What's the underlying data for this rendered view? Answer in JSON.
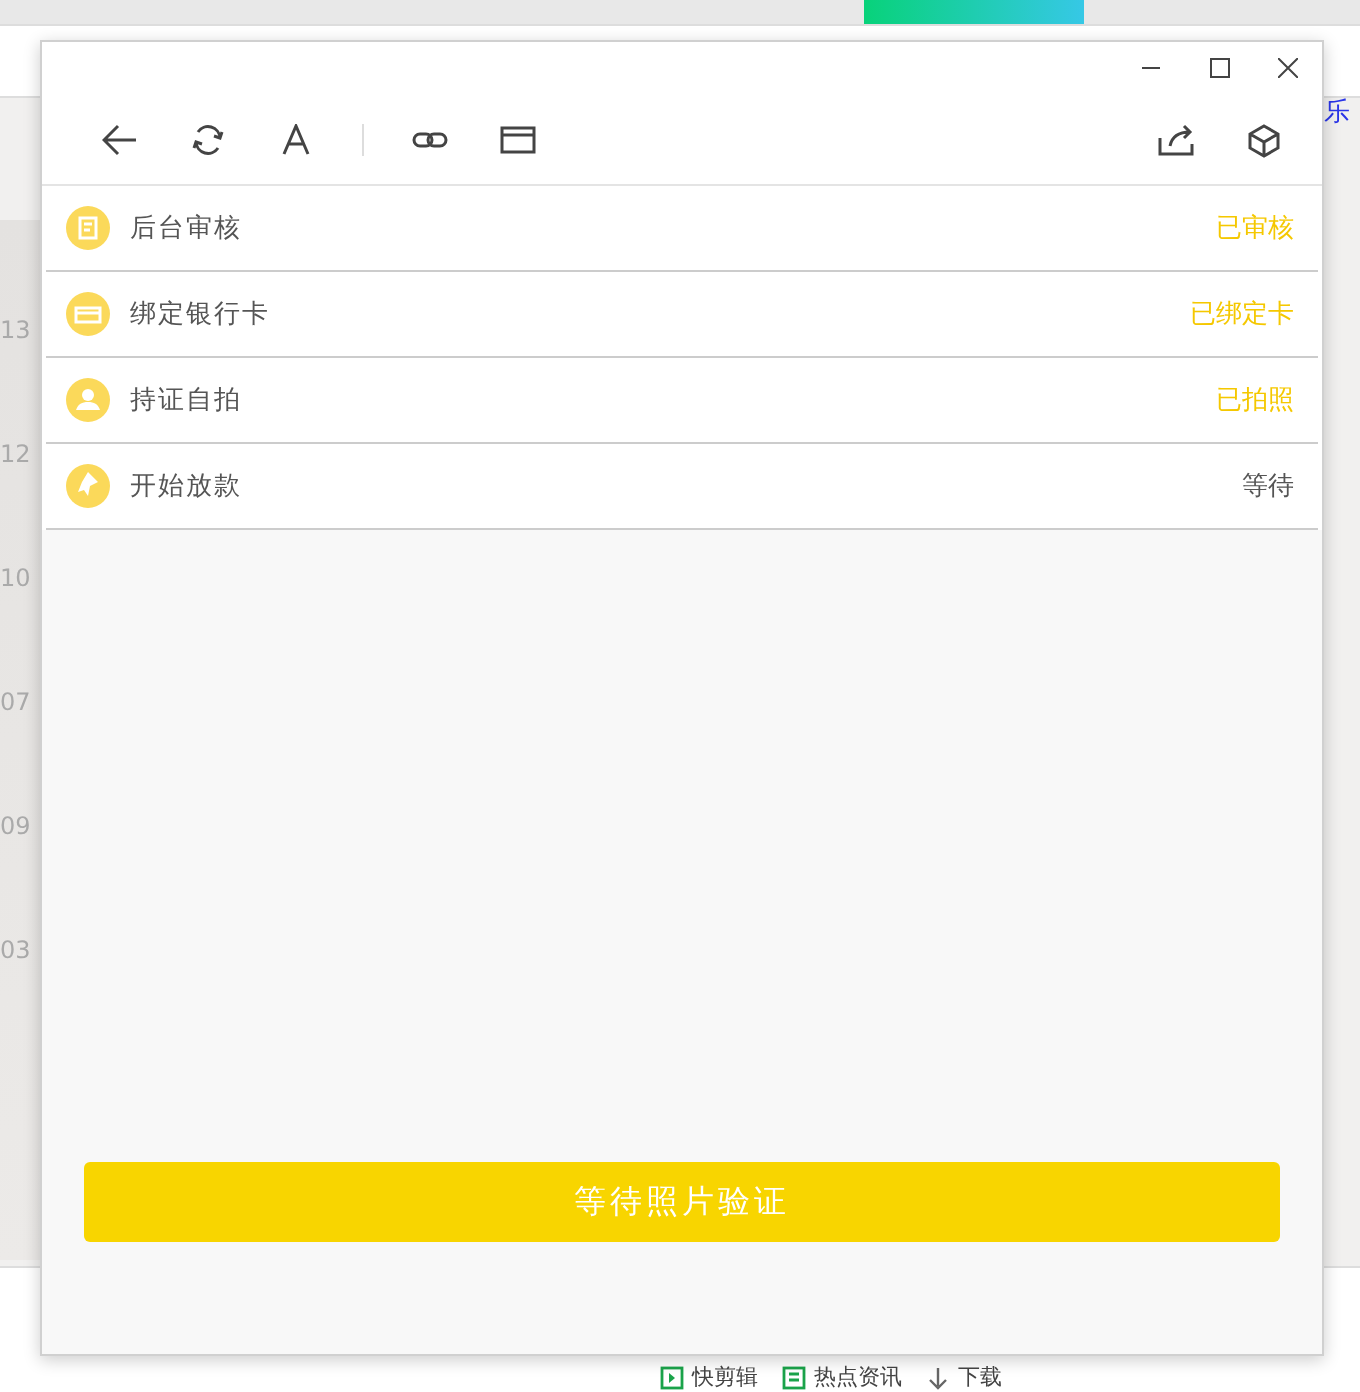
{
  "background": {
    "side_numbers": [
      "13",
      "12",
      "10",
      "07",
      "09",
      "03"
    ],
    "right_link": "乐",
    "status_bar": [
      {
        "kind": "play",
        "label": "快剪辑"
      },
      {
        "kind": "news",
        "label": "热点资讯"
      },
      {
        "kind": "download",
        "label": "下载"
      }
    ]
  },
  "window": {
    "steps": [
      {
        "kind": "doc",
        "label": "后台审核",
        "status": "已审核",
        "done": true
      },
      {
        "kind": "card",
        "label": "绑定银行卡",
        "status": "已绑定卡",
        "done": true
      },
      {
        "kind": "person",
        "label": "持证自拍",
        "status": "已拍照",
        "done": true
      },
      {
        "kind": "pen",
        "label": "开始放款",
        "status": "等待",
        "done": false
      }
    ],
    "action_button": "等待照片验证"
  }
}
